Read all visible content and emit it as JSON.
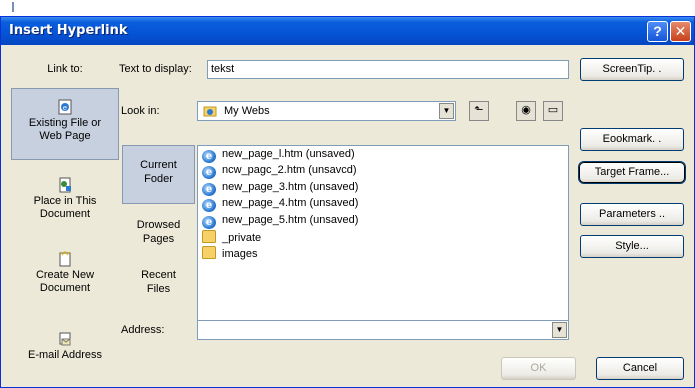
{
  "dialog": {
    "title": "Insert Hyperlink",
    "help_glyph": "?",
    "close_glyph": "✕"
  },
  "link_to": {
    "label": "Link to:",
    "items": [
      {
        "label_line1": "Existing File or",
        "label_line2": "Web Page",
        "icon": "web-page-icon",
        "selected": true
      },
      {
        "label_line1": "Place in This",
        "label_line2": "Document",
        "icon": "place-in-document-icon",
        "selected": false
      },
      {
        "label_line1": "Create New",
        "label_line2": "Document",
        "icon": "new-document-icon",
        "selected": false
      },
      {
        "label_line1": "E-mail Address",
        "label_line2": "",
        "icon": "email-icon",
        "selected": false
      }
    ]
  },
  "text_to_display": {
    "label": "Text to display:",
    "value": "tekst"
  },
  "screentip_button": "ScreenTip. .",
  "look_in": {
    "label": "Look in:",
    "value": "My Webs"
  },
  "browse_panel": {
    "items": [
      {
        "line1": "Current",
        "line2": "Foder",
        "selected": true
      },
      {
        "line1": "Drowsed",
        "line2": "Pages",
        "selected": false
      },
      {
        "line1": "Recent",
        "line2": "Files",
        "selected": false
      }
    ]
  },
  "files": [
    {
      "name": "new_page_l.htm (unsaved)",
      "icon": "ie-page-icon"
    },
    {
      "name": "ncw_pagc_2.htm (unsavcd)",
      "icon": "ie-page-icon"
    },
    {
      "name": "new_page_3.htm (unsaved)",
      "icon": "ie-page-icon"
    },
    {
      "name": "new_page_4.htm (unsaved)",
      "icon": "ie-page-icon"
    },
    {
      "name": "new_page_5.htm (unsaved)",
      "icon": "ie-page-icon"
    },
    {
      "name": "_private",
      "icon": "folder-icon"
    },
    {
      "name": "images",
      "icon": "folder-icon"
    }
  ],
  "right_buttons": {
    "bookmark": "Eookmark. .",
    "target_frame": "Target Frame...",
    "parameters": "Parameters ..",
    "style": "Style..."
  },
  "address": {
    "label": "Address:",
    "value": ""
  },
  "footer": {
    "ok": "OK",
    "cancel": "Cancel"
  }
}
